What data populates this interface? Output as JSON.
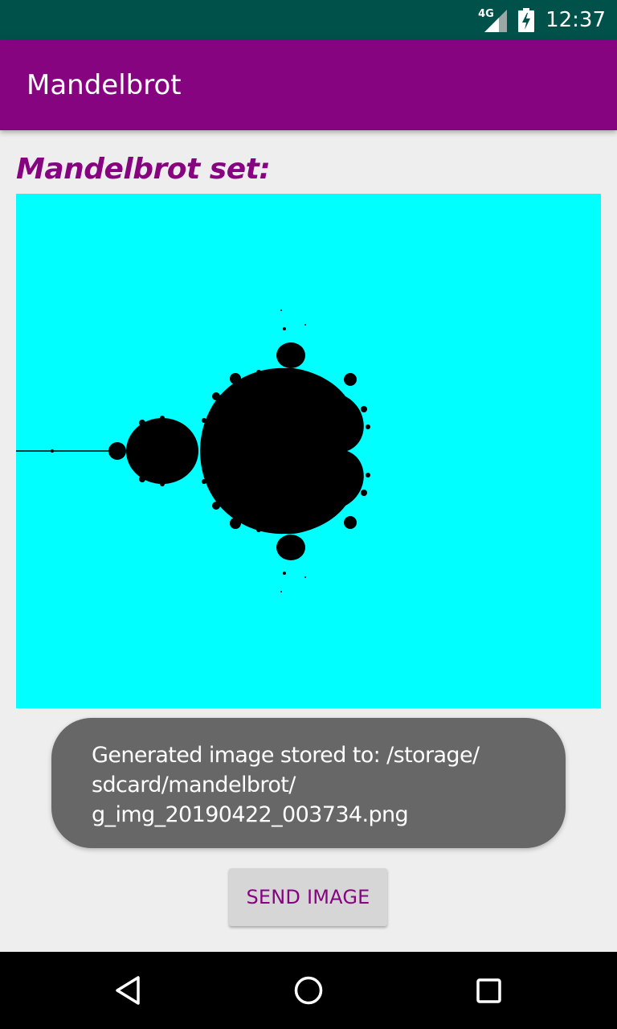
{
  "status_bar": {
    "network_type": "4G",
    "time": "12:37",
    "icons": [
      "signal-icon",
      "battery-charging-icon"
    ],
    "background": "#005149"
  },
  "app_bar": {
    "title": "Mandelbrot",
    "background": "#870480"
  },
  "content": {
    "heading": "Mandelbrot set:",
    "image": {
      "description_icon": "mandelbrot-fractal-image",
      "fill_color": "#00ffff",
      "set_color": "#000000"
    }
  },
  "toast": {
    "lines": [
      "Generated image stored to: /storage/",
      "sdcard/mandelbrot/",
      "g_img_20190422_003734.png"
    ]
  },
  "send_button": {
    "label": "SEND IMAGE"
  },
  "nav_bar": {
    "icons": [
      "back-icon",
      "home-icon",
      "recents-icon"
    ]
  },
  "colors": {
    "accent": "#870480",
    "background": "#eeeeee",
    "toast_bg": "#676767"
  }
}
